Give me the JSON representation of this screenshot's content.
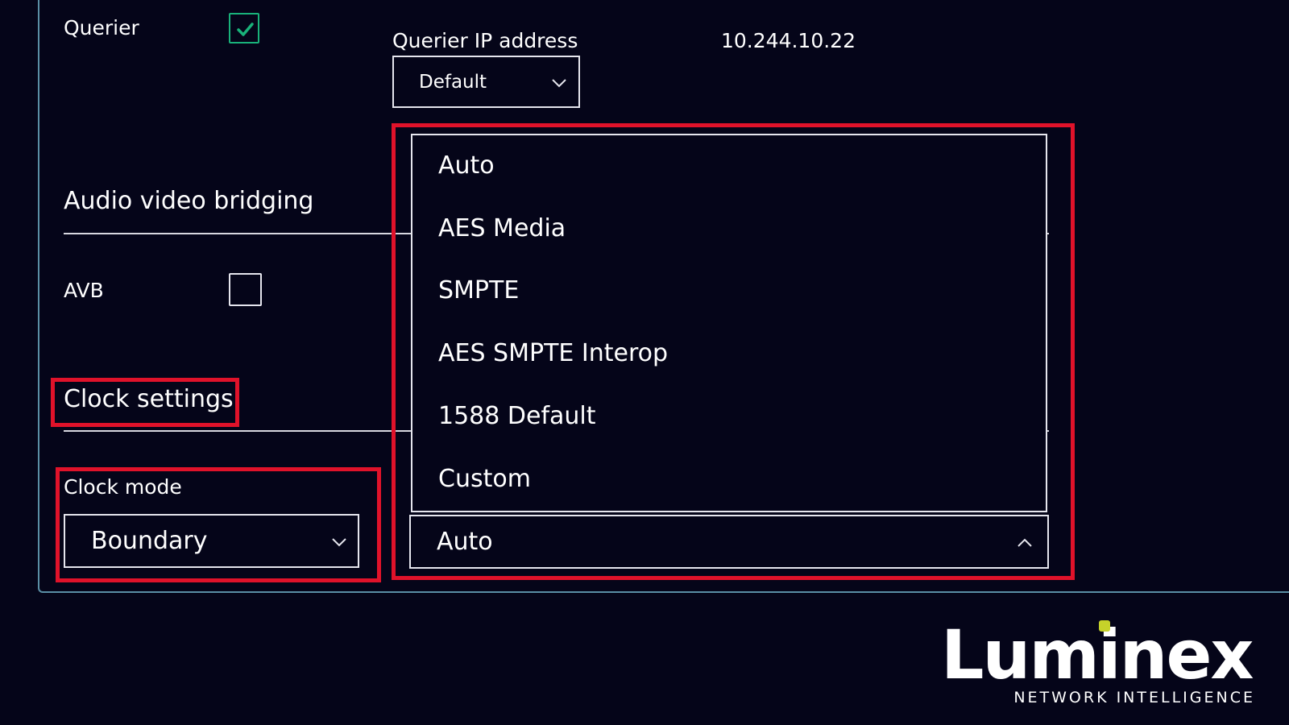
{
  "multicast": {
    "querier_label": "Querier",
    "querier_checked": true,
    "querier_ip_label": "Querier IP address",
    "querier_ip_value": "10.244.10.22",
    "querier_ip_select_value": "Default"
  },
  "avb_section": {
    "title": "Audio video bridging",
    "avb_label": "AVB",
    "avb_checked": false
  },
  "clock_section": {
    "title": "Clock settings",
    "clock_mode_label": "Clock mode",
    "clock_mode_value": "Boundary",
    "profile_value": "Auto",
    "profile_options": [
      "Auto",
      "AES Media",
      "SMPTE",
      "AES SMPTE Interop",
      "1588 Default",
      "Custom"
    ]
  },
  "brand": {
    "name": "Luminex",
    "tagline": "NETWORK INTELLIGENCE",
    "accent_color": "#c6d22a",
    "highlight_color": "#e0122a",
    "check_color": "#19b27a"
  },
  "icons": {
    "check": "check-icon",
    "chevron_down": "chevron-down-icon",
    "chevron_up": "chevron-up-icon"
  }
}
